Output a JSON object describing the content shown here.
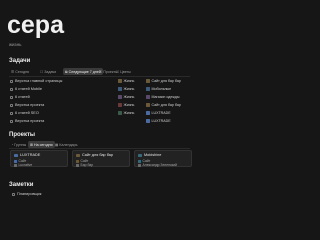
{
  "header": {
    "title": "сера",
    "subtitle": "жизнь"
  },
  "tasks": {
    "title": "Задачи",
    "tabs": [
      {
        "icon": "☰",
        "label": "Сегодня"
      },
      {
        "icon": "☐",
        "label": "Задачи"
      },
      {
        "icon": "⧉",
        "label": "Следующие 7 дней"
      },
      {
        "icon": "☐",
        "label": "Проекты"
      },
      {
        "icon": "☐",
        "label": "Цветы"
      }
    ],
    "rows": [
      {
        "left": "Верстка главной страницы",
        "right": "Сайт для бар бар"
      },
      {
        "left": "6 статей Mobile",
        "right": "Мобильные"
      },
      {
        "left": "6 статей",
        "right": "Магазин одежды"
      },
      {
        "left": "Верстка проекта",
        "right": "Сайт для бар бар"
      },
      {
        "left": "6 статей SEO",
        "right": "LUXTRADE"
      },
      {
        "left": "Верстка проекта",
        "right": "LUXTRADE"
      }
    ],
    "tags": [
      {
        "label": "Жизнь",
        "color": "#6a5a3a"
      },
      {
        "label": "Жизнь",
        "color": "#3e5a7a"
      },
      {
        "label": "Жизнь",
        "color": "#5a4a6a"
      },
      {
        "label": "Жизнь",
        "color": "#6a3a3a"
      },
      {
        "label": "Жизнь",
        "color": "#3a5a4a"
      }
    ]
  },
  "projects": {
    "title": "Проекты",
    "tabs": [
      {
        "icon": "◔",
        "label": "Группы"
      },
      {
        "icon": "⊞",
        "label": "На сегодня"
      },
      {
        "icon": "▦",
        "label": "Календарь"
      }
    ],
    "cards": [
      {
        "name": "LUXTRADE",
        "meta1": "Сайт",
        "meta2": "Lucrative",
        "color": "#4a6aa0"
      },
      {
        "name": "Сайт для бар бар",
        "meta1": "Сайт",
        "meta2": "Бар бар",
        "color": "#6a5a3a"
      },
      {
        "name": "Mobishine",
        "meta1": "Сайт",
        "meta2": "Александр Зеленский",
        "color": "#3a6a7a"
      }
    ]
  },
  "notes": {
    "title": "Заметки",
    "item": "Планировщик"
  }
}
